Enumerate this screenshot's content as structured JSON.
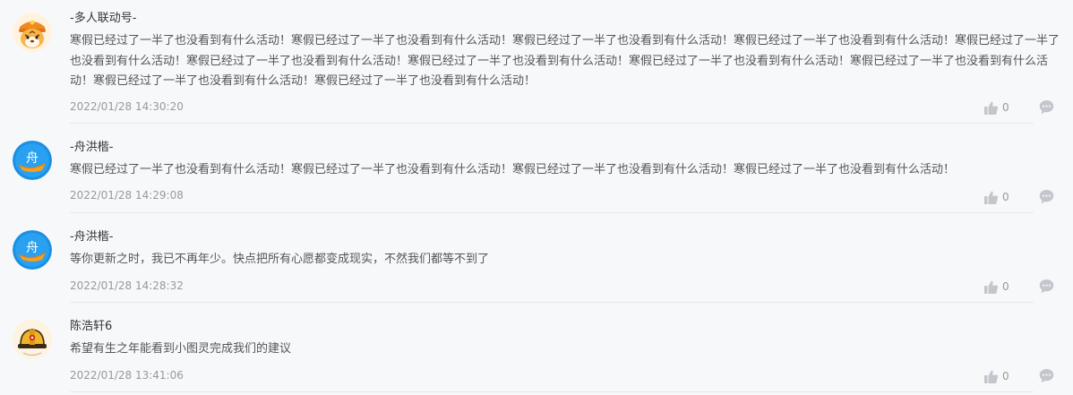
{
  "comments": [
    {
      "user": "-多人联动号-",
      "avatar_icon": "tiger-avatar-icon",
      "text": "寒假已经过了一半了也没看到有什么活动！寒假已经过了一半了也没看到有什么活动！寒假已经过了一半了也没看到有什么活动！寒假已经过了一半了也没看到有什么活动！寒假已经过了一半了也没看到有什么活动！寒假已经过了一半了也没看到有什么活动！寒假已经过了一半了也没看到有什么活动！寒假已经过了一半了也没看到有什么活动！寒假已经过了一半了也没看到有什么活动！寒假已经过了一半了也没看到有什么活动！寒假已经过了一半了也没看到有什么活动！",
      "time": "2022/01/28 14:30:20",
      "likes": "0"
    },
    {
      "user": "-舟洪楷-",
      "avatar_icon": "boat-avatar-icon",
      "avatar_char": "舟",
      "text": "寒假已经过了一半了也没看到有什么活动！寒假已经过了一半了也没看到有什么活动！寒假已经过了一半了也没看到有什么活动！寒假已经过了一半了也没看到有什么活动！",
      "time": "2022/01/28 14:29:08",
      "likes": "0"
    },
    {
      "user": "-舟洪楷-",
      "avatar_icon": "boat-avatar-icon",
      "avatar_char": "舟",
      "text": "等你更新之时，我已不再年少。快点把所有心愿都变成现实，不然我们都等不到了",
      "time": "2022/01/28 14:28:32",
      "likes": "0"
    },
    {
      "user": "陈浩轩6",
      "avatar_icon": "helmet-avatar-icon",
      "text": "希望有生之年能看到小图灵完成我们的建议",
      "time": "2022/01/28 13:41:06",
      "likes": "0"
    }
  ],
  "icons": {
    "like": "thumbs-up-icon",
    "reply": "comment-bubble-icon"
  },
  "colors": {
    "background": "#f7f8fa",
    "name": "#333333",
    "content": "#555555",
    "meta": "#999999",
    "icon": "#c4c6cc",
    "boat_avatar": "#1a8fe3"
  }
}
